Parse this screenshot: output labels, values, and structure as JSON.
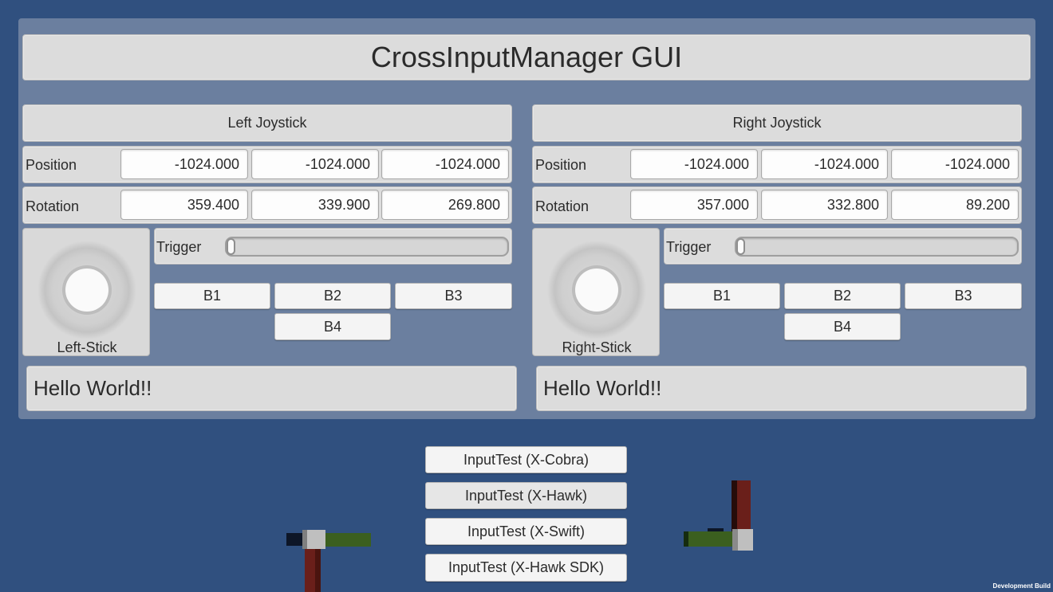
{
  "title": "CrossInputManager GUI",
  "left": {
    "header": "Left Joystick",
    "position_label": "Position",
    "position": [
      "-1024.000",
      "-1024.000",
      "-1024.000"
    ],
    "rotation_label": "Rotation",
    "rotation": [
      "359.400",
      "339.900",
      "269.800"
    ],
    "trigger_label": "Trigger",
    "trigger_value": 0.0,
    "buttons": [
      "B1",
      "B2",
      "B3",
      "B4"
    ],
    "stick_label": "Left-Stick",
    "message": "Hello World!!"
  },
  "right": {
    "header": "Right Joystick",
    "position_label": "Position",
    "position": [
      "-1024.000",
      "-1024.000",
      "-1024.000"
    ],
    "rotation_label": "Rotation",
    "rotation": [
      "357.000",
      "332.800",
      "89.200"
    ],
    "trigger_label": "Trigger",
    "trigger_value": 0.0,
    "buttons": [
      "B1",
      "B2",
      "B3",
      "B4"
    ],
    "stick_label": "Right-Stick",
    "message": "Hello World!!"
  },
  "scene_buttons": [
    "InputTest (X-Cobra)",
    "InputTest (X-Hawk)",
    "InputTest (X-Swift)",
    "InputTest (X-Hawk SDK)"
  ],
  "dev_build": "Development Build",
  "colors": {
    "background": "#30507f",
    "panel": "#6b7f9f",
    "box": "#dcdcdc"
  }
}
